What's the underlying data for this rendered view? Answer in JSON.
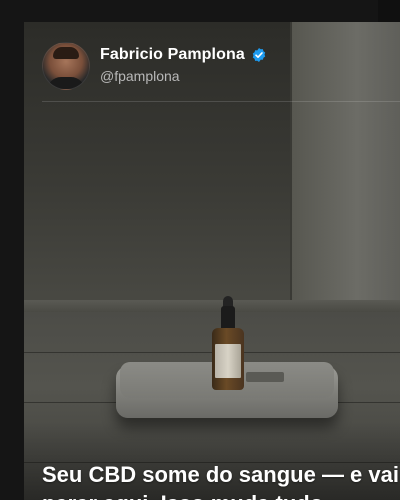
{
  "post": {
    "author_name": "Fabricio Pamplona",
    "handle": "@fpamplona",
    "verified": true,
    "caption": "Seu CBD some do sangue — e vai parar aqui. Isso muda tudo."
  },
  "colors": {
    "verified_badge": "#1d9bf0",
    "background": "#151515",
    "text": "#ffffff",
    "handle_text": "#b9b9b9"
  }
}
